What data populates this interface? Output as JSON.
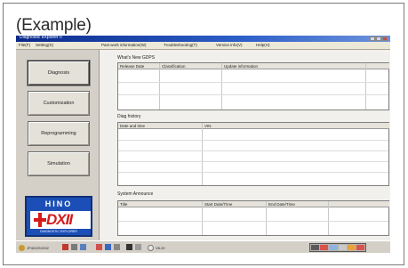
{
  "example_label": "(Example)",
  "window": {
    "title": "Diagnostic eXplorer II",
    "controls": [
      "minimize",
      "maximize",
      "close"
    ]
  },
  "menu": [
    "File(F)",
    "Setting(S)",
    "Past work information(W)",
    "Troubleshooting(T)",
    "Version info(V)",
    "Help(H)"
  ],
  "nav": {
    "buttons": [
      "Diagnosis",
      "Customization",
      "Reprogramming",
      "Simulation"
    ],
    "active_index": 0
  },
  "logo": {
    "brand": "HINO",
    "product": "DXII",
    "subtitle": "DIAGNOSTIC EXPLORER"
  },
  "whats_new": {
    "title": "What's New GDPS",
    "columns": [
      "Release Date",
      "Classification",
      "Update information"
    ]
  },
  "diag_history": {
    "title": "Diag history",
    "columns": [
      "Date and time",
      "VIN"
    ]
  },
  "system_announce": {
    "title": "System Announce",
    "columns": [
      "Title",
      "Start Date/Time",
      "End Date/Time"
    ]
  },
  "statusbar": {
    "left_text": "JP4DGSX002",
    "version_text": "V8.20"
  },
  "colors": {
    "titlebar": "#0a2a8a",
    "logo_blue": "#1b4fb7",
    "logo_red": "#d61a1a"
  }
}
